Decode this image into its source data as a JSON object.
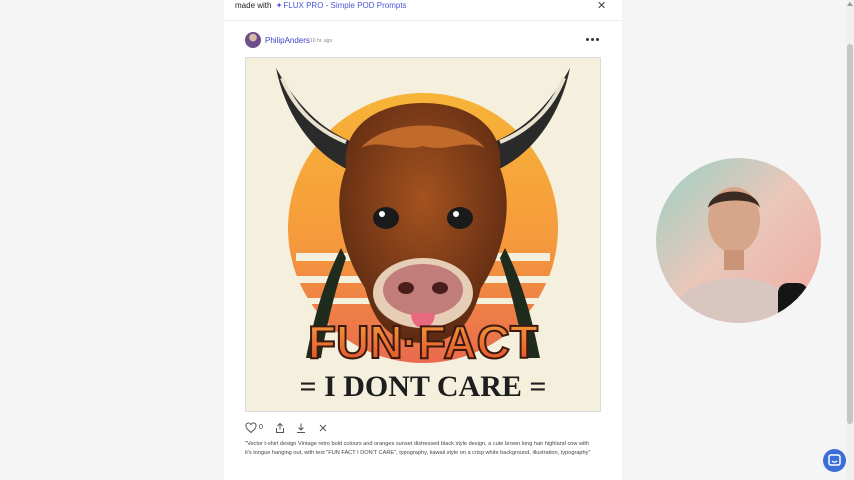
{
  "header": {
    "made_with_prefix": "made with",
    "made_with_link": "FLUX PRO - Simple POD Prompts",
    "close_glyph": "✕"
  },
  "post": {
    "username": "PhilipAnders",
    "timestamp": "10 hr. ago",
    "image": {
      "headline": "FUN·FACT",
      "subline": "= I DONT CARE ="
    },
    "actions": {
      "like_count": "0"
    },
    "prompt": "\"Vector t-shirt design Vintage retro bold colours and oranges sunset distressed black style design, a cute brown long hair highland cow with it's tongue hanging out, with text \"FUN FACT I DON'T CARE\", typography, kawaii style on a crisp white background, illustration, typography\""
  },
  "colors": {
    "accent": "#4a55d6",
    "username": "#3b45c8",
    "chat_button": "#3b6fd6"
  },
  "icons": [
    "sparkle-icon",
    "close-icon",
    "more-icon",
    "heart-icon",
    "share-icon",
    "download-icon",
    "close-small-icon",
    "chat-icon"
  ]
}
